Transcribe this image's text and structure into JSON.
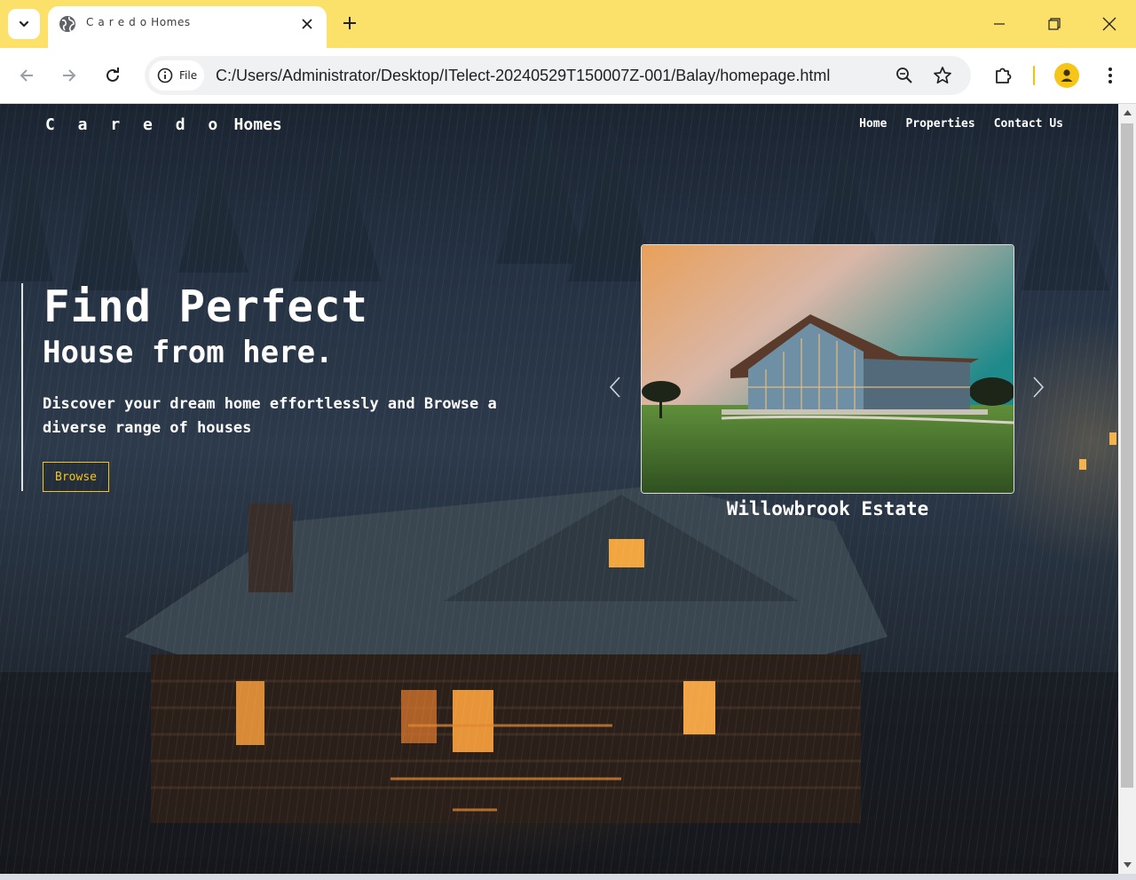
{
  "browser": {
    "tab_title": "C a r e d o Homes",
    "address_chip": "File",
    "url": "C:/Users/Administrator/Desktop/ITelect-20240529T150007Z-001/Balay/homepage.html"
  },
  "site": {
    "logo_spaced": "C a r e d o",
    "logo_word": " Homes",
    "nav": [
      "Home",
      "Properties",
      "Contact Us"
    ]
  },
  "hero": {
    "title": "Find Perfect",
    "subtitle": "House from here.",
    "description": "Discover your dream home effortlessly and Browse a diverse range of houses",
    "button": "Browse"
  },
  "carousel": {
    "caption": "Willowbrook Estate"
  },
  "colors": {
    "titlebar": "#fbe06a",
    "accent": "#f5c518",
    "text": "#ffffff"
  },
  "icons": [
    "tab-search-icon",
    "globe-icon",
    "close-icon",
    "plus-icon",
    "minimize-icon",
    "restore-icon",
    "back-icon",
    "forward-icon",
    "reload-icon",
    "info-icon",
    "zoom-icon",
    "star-icon",
    "extensions-icon",
    "profile-icon",
    "more-icon",
    "chevron-left-icon",
    "chevron-right-icon"
  ]
}
